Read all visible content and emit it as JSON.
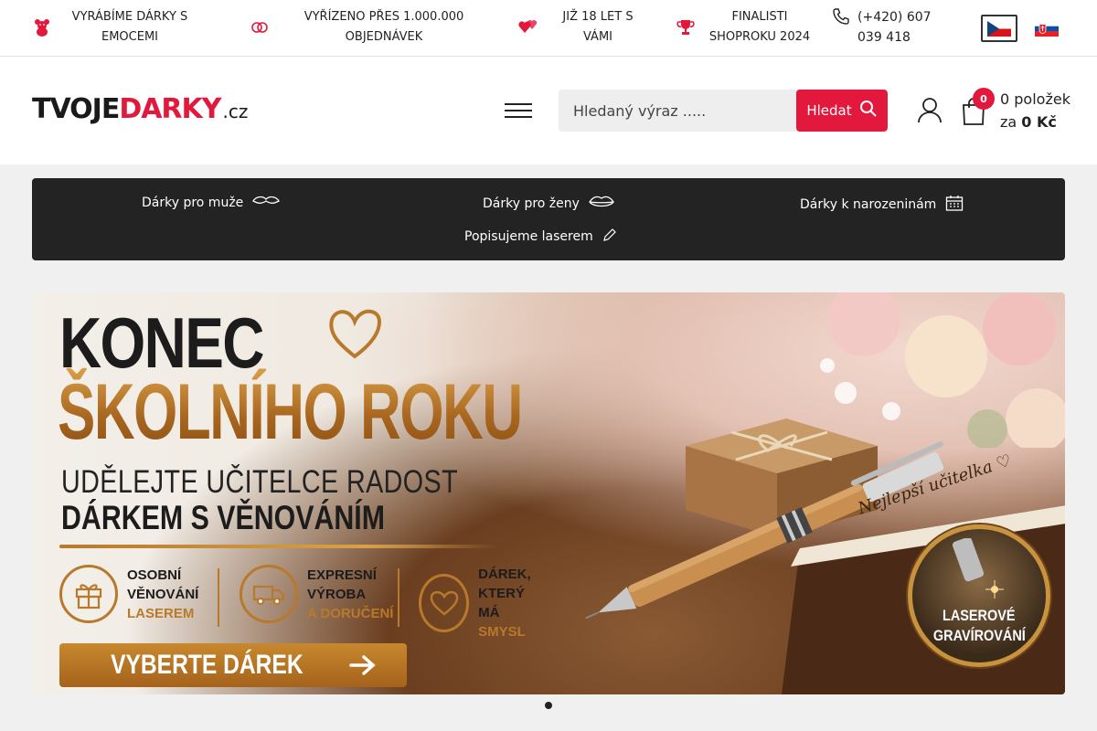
{
  "topbar": {
    "items": [
      {
        "icon": "teddy-bear-icon",
        "text_l1": "VYRÁBÍME DÁRKY S",
        "text_l2": "EMOCEMI"
      },
      {
        "icon": "rings-icon",
        "text_l1": "VYŘÍZENO PŘES 1.000.000",
        "text_l2": "OBJEDNÁVEK"
      },
      {
        "icon": "hearts-icon",
        "text_l1": "JIŽ 18 LET S",
        "text_l2": "VÁMI"
      },
      {
        "icon": "trophy-icon",
        "text_l1": "FINALISTI",
        "text_l2": "SHOPROKU 2024"
      }
    ],
    "phone_l1": "(+420) 607",
    "phone_l2": "039 418",
    "flags": [
      "cz-flag",
      "sk-flag"
    ]
  },
  "header": {
    "logo_part1": "TVOJE",
    "logo_part2": "DARKY",
    "logo_part3": ".cz",
    "search_placeholder": "Hledaný výraz .....",
    "search_button": "Hledat",
    "cart_count": "0",
    "cart_items_text": "0 položek",
    "cart_total_prefix": "za",
    "cart_total": "0 Kč"
  },
  "nav": {
    "items": [
      {
        "label": "Dárky pro muže",
        "icon": "mustache-icon"
      },
      {
        "label": "Dárky pro ženy",
        "icon": "lips-icon"
      },
      {
        "label": "Dárky k narozeninám",
        "icon": "calendar-icon"
      },
      {
        "label": "Popisujeme laserem",
        "icon": "pencil-icon"
      }
    ]
  },
  "banner": {
    "headline1": "KONEC",
    "headline2": "ŠKOLNÍHO ROKU",
    "sub1": "UDĚLEJTE UČITELCE RADOST",
    "sub2": "DÁRKEM S VĚNOVÁNÍM",
    "features": [
      {
        "icon": "gift-icon",
        "l1": "OSOBNÍ",
        "l2": "VĚNOVÁNÍ",
        "l3": "LASEREM"
      },
      {
        "icon": "truck-icon",
        "l1": "EXPRESNÍ",
        "l2": "VÝROBA",
        "l3": "A DORUČENÍ"
      },
      {
        "icon": "heart-icon",
        "l1": "DÁREK,",
        "l2": "KTERÝ MÁ",
        "l3": "SMYSL"
      }
    ],
    "cta": "VYBERTE DÁREK",
    "pen_engraving": "Nejlepší učitelka ♡",
    "laser_l1": "LASEROVÉ",
    "laser_l2": "GRAVÍROVÁNÍ"
  },
  "colors": {
    "accent": "#e2183d",
    "gold": "#b8792c",
    "nav_bg": "#232323"
  }
}
